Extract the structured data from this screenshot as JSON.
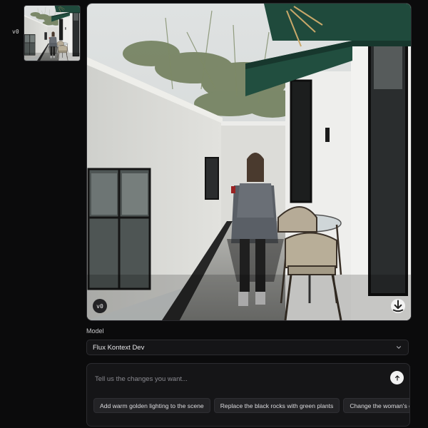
{
  "history": {
    "version_label": "v0"
  },
  "preview": {
    "version_badge": "v0",
    "download_icon": "download-icon"
  },
  "model": {
    "label": "Model",
    "selected": "Flux Kontext Dev",
    "chevron_icon": "chevron-down-icon"
  },
  "prompt": {
    "placeholder": "Tell us the changes you want...",
    "value": "",
    "send_icon": "arrow-up-icon"
  },
  "suggestions": [
    "Add warm golden lighting to the scene",
    "Replace the black rocks with green plants",
    "Change the woman's outfit to"
  ],
  "colors": {
    "background": "#0b0b0c",
    "panel": "#151517",
    "awning": "#1f4a3c"
  }
}
